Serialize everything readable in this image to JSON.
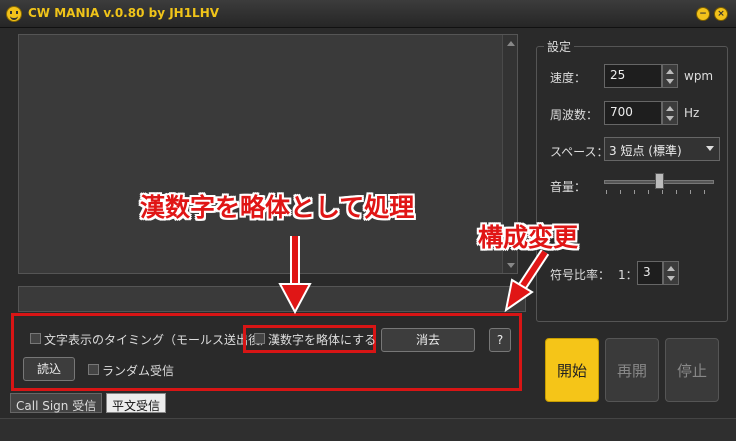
{
  "window": {
    "title": "CW MANIA v.0.80 by JH1LHV",
    "minimize_glyph": "−",
    "close_glyph": "×"
  },
  "settings": {
    "group_label": "設定",
    "speed_label": "速度：",
    "speed_value": "25",
    "speed_unit": "wpm",
    "freq_label": "周波数：",
    "freq_value": "700",
    "freq_unit": "Hz",
    "space_label": "スペース：",
    "space_value": "3 短点 (標準)",
    "volume_label": "音量：",
    "volume_level": 0.5,
    "ratio_label": "符号比率：",
    "ratio_prefix": "1：",
    "ratio_value": "3"
  },
  "controls": {
    "timing_checkbox": "文字表示のタイミング（モールス送出後）",
    "kanji_checkbox": "漢数字を略体にする",
    "clear_button": "消去",
    "help_button": "?",
    "read_button": "読込",
    "random_checkbox": "ランダム受信"
  },
  "big_buttons": {
    "start": "開始",
    "resume": "再開",
    "stop": "停止"
  },
  "tabs": [
    "Call Sign 受信",
    "平文受信"
  ],
  "annotations": {
    "kanji": "漢数字を略体として処理",
    "config": "構成変更"
  },
  "colors": {
    "accent": "#f5c518",
    "annotation": "#e01616"
  }
}
